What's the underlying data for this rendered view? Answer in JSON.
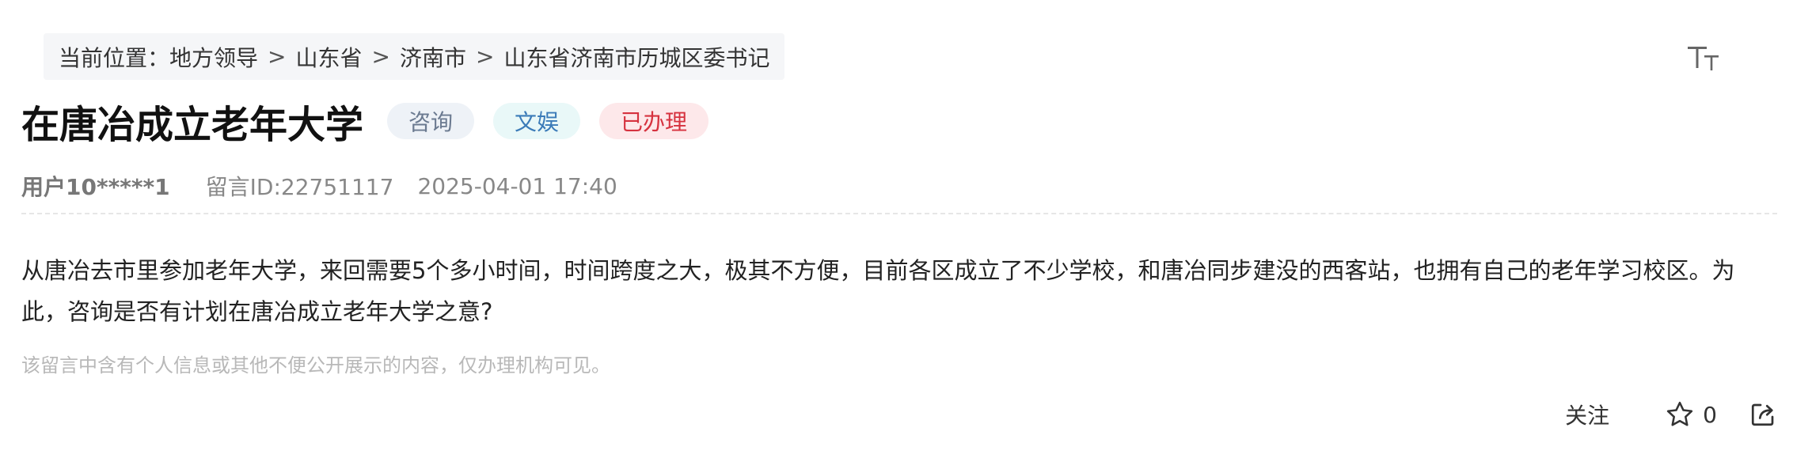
{
  "breadcrumb": {
    "prefix": "当前位置：",
    "items": [
      "地方领导",
      "山东省",
      "济南市",
      "山东省济南市历城区委书记"
    ],
    "separator": ">"
  },
  "font_size_icon": "text-size-icon",
  "message": {
    "title": "在唐冶成立老年大学",
    "tags": [
      {
        "label": "咨询",
        "color": "#6b7a90"
      },
      {
        "label": "文娱",
        "color": "#3b7bb8"
      },
      {
        "label": "已办理",
        "color": "#d6323f"
      }
    ],
    "user": "用户10*****1",
    "message_id": "留言ID:22751117",
    "datetime": "2025-04-01 17:40",
    "content": "从唐冶去市里参加老年大学，来回需要5个多小时间，时间跨度之大，极其不方便，目前各区成立了不少学校，和唐冶同步建没的西客站，也拥有自己的老年学习校区。为此，咨询是否有计划在唐冶成立老年大学之意?",
    "notice": "该留言中含有个人信息或其他不便公开展示的内容，仅办理机构可见。"
  },
  "actions": {
    "follow_label": "关注",
    "star_icon": "star-icon",
    "star_count": "0",
    "share_icon": "share-icon"
  }
}
